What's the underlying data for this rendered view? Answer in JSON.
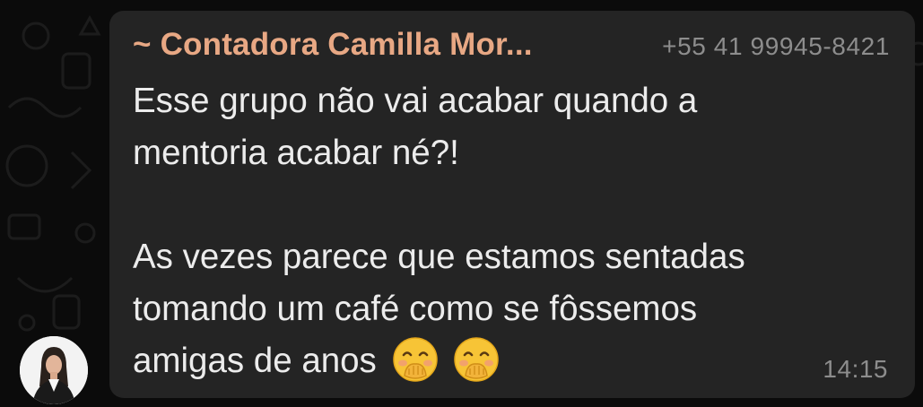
{
  "message": {
    "sender": "~ Contadora Camilla Mor...",
    "phone": "+55 41 99945-8421",
    "paragraph1_line1": "Esse grupo não vai acabar quando a",
    "paragraph1_line2": "mentoria acabar né?!",
    "paragraph2_line1": "As vezes parece que estamos sentadas",
    "paragraph2_line2": "tomando um café como se fôssemos",
    "paragraph2_line3": "amigas de anos",
    "emojis": [
      "face-with-hand-over-mouth-emoji",
      "face-with-hand-over-mouth-emoji"
    ],
    "time": "14:15"
  },
  "colors": {
    "background": "#0b0b0b",
    "bubble": "#242424",
    "sender_name": "#e8a884",
    "meta_text": "#8d8d8d",
    "body_text": "#ececec"
  }
}
